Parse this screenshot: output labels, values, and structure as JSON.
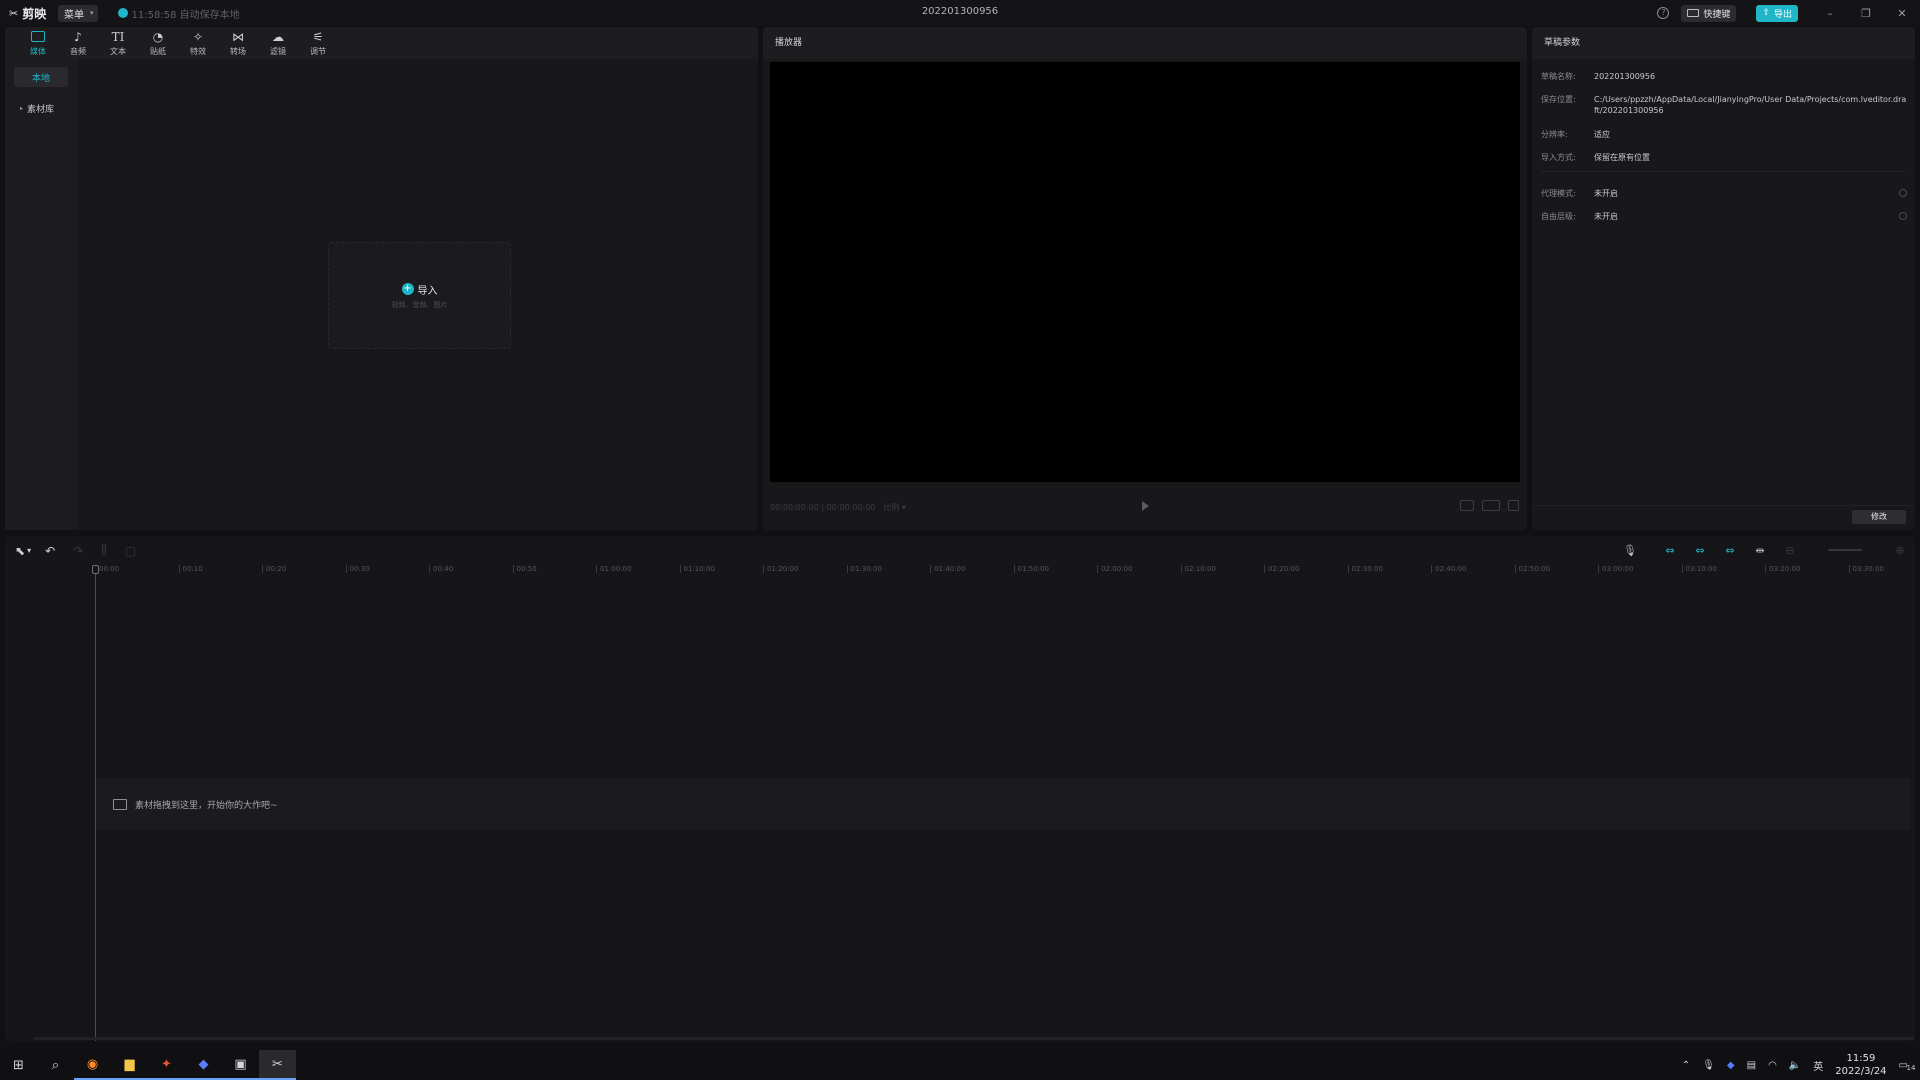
{
  "titlebar": {
    "app_name": "剪映",
    "menu_label": "菜单",
    "autosave": "11:58:58 自动保存本地",
    "project_title": "202201300956",
    "shortcut_label": "快捷键",
    "export_label": "导出"
  },
  "media": {
    "tools": [
      {
        "label": "媒体",
        "icon": "media-icon"
      },
      {
        "label": "音频",
        "icon": "audio-icon"
      },
      {
        "label": "文本",
        "icon": "text-icon"
      },
      {
        "label": "贴纸",
        "icon": "sticker-icon"
      },
      {
        "label": "特效",
        "icon": "effects-icon"
      },
      {
        "label": "转场",
        "icon": "transition-icon"
      },
      {
        "label": "滤镜",
        "icon": "filter-icon"
      },
      {
        "label": "调节",
        "icon": "adjust-icon"
      }
    ],
    "nav_local": "本地",
    "nav_library": "素材库",
    "import_label": "导入",
    "import_sub": "视频、音频、图片"
  },
  "player": {
    "title": "播放器",
    "timecode": "00:00:00:00 | 00:00:00:00",
    "ratio": "比例"
  },
  "props": {
    "title": "草稿参数",
    "rows": [
      {
        "k": "草稿名称:",
        "v": "202201300956"
      },
      {
        "k": "保存位置:",
        "v": "C:/Users/ppzzh/AppData/Local/JianyingPro/User Data/Projects/com.lveditor.draft/202201300956"
      },
      {
        "k": "分辨率:",
        "v": "适应"
      },
      {
        "k": "导入方式:",
        "v": "保留在原有位置"
      },
      {
        "k": "代理模式:",
        "v": "未开启"
      },
      {
        "k": "自由层级:",
        "v": "未开启"
      }
    ],
    "modify_label": "修改"
  },
  "timeline": {
    "ticks": [
      "00:00",
      "00:10",
      "00:20",
      "00:30",
      "00:40",
      "00:50",
      "01:00:00",
      "01:10:00",
      "01:20:00",
      "01:30:00",
      "01:40:00",
      "01:50:00",
      "02:00:00",
      "02:10:00",
      "02:20:00",
      "02:30:00",
      "02:40:00",
      "02:50:00",
      "03:00:00",
      "03:10:00",
      "03:20:00",
      "03:30:00"
    ],
    "drop_hint": "素材拖拽到这里，开始你的大作吧~"
  },
  "taskbar": {
    "time": "11:59",
    "date": "2022/3/24",
    "ime": "英",
    "notif_count": "14"
  },
  "colors": {
    "accent": "#1fb6c7"
  }
}
